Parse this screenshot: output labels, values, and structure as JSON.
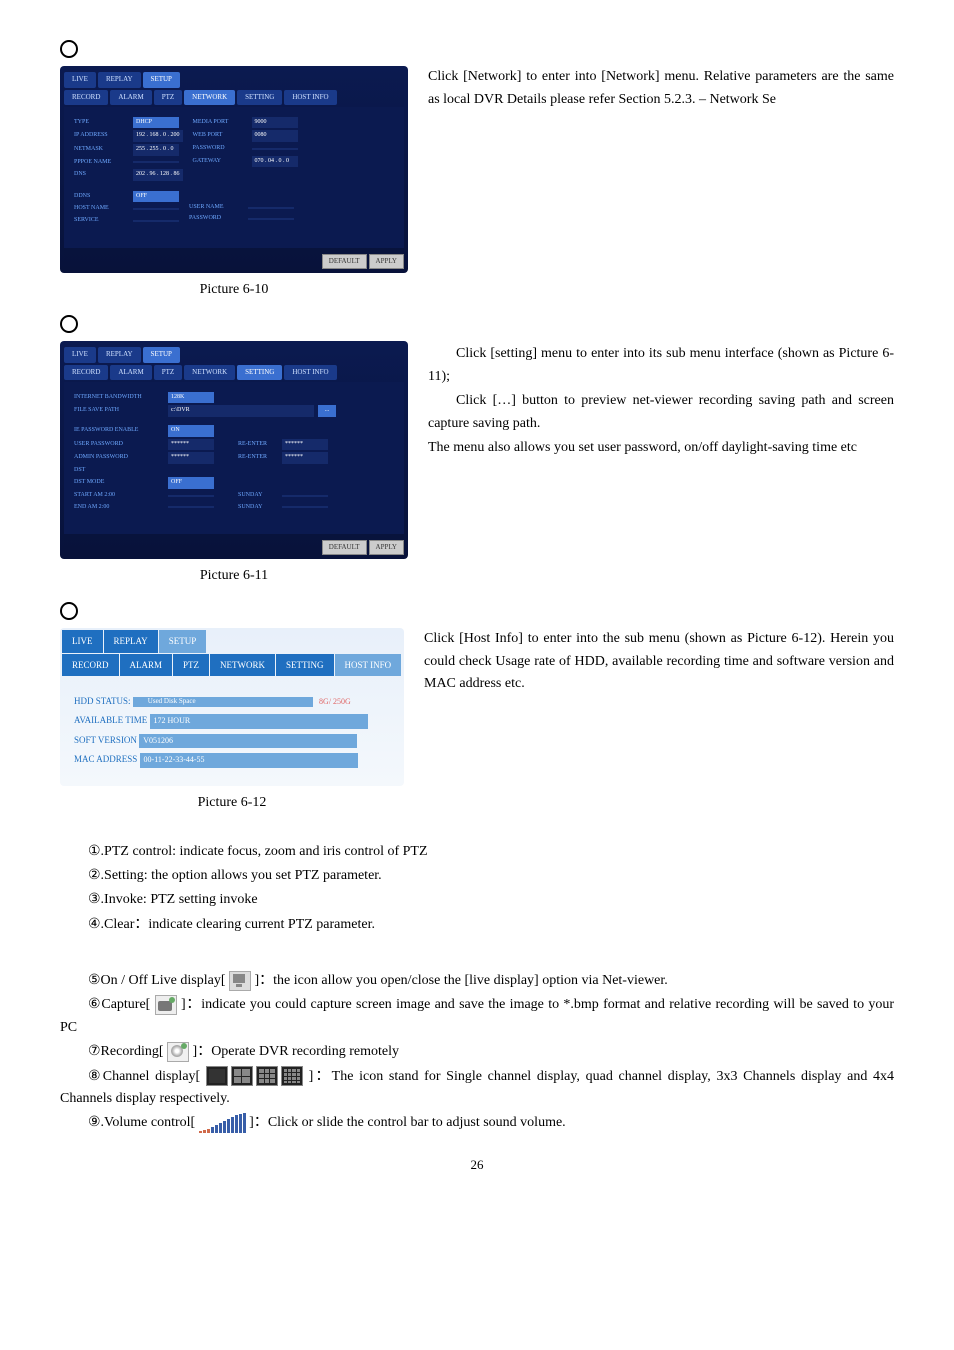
{
  "bullets": {
    "b1": "",
    "b2": "",
    "b3": ""
  },
  "panel_network": {
    "tabs_top": {
      "live": "LIVE",
      "replay": "REPLAY",
      "setup": "SETUP"
    },
    "tabs_sub": {
      "record": "RECORD",
      "alarm": "ALARM",
      "ptz": "PTZ",
      "network": "NETWORK",
      "setting": "SETTING",
      "hostinfo": "HOST INFO"
    },
    "left": {
      "type_k": "TYPE",
      "type_v": "DHCP",
      "ip_k": "IP ADDRESS",
      "ip_v": "192 . 168 . 0 . 200",
      "mask_k": "NETMASK",
      "mask_v": "255 . 255 . 0 . 0",
      "pppoe_k": "PPPOE NAME",
      "pppoe_v": "",
      "dns_k": "DNS",
      "dns_v": "202 . 96 . 128 . 86"
    },
    "mid": {
      "media_k": "MEDIA PORT",
      "media_v": "9000",
      "web_k": "WEB PORT",
      "web_v": "0080",
      "pass_k": "PASSWORD",
      "pass_v": "",
      "gate_k": "GATEWAY",
      "gate_v": "070 . 04 . 0 . 0"
    },
    "bottom": {
      "ddns_k": "DDNS",
      "ddns_v": "OFF",
      "host_k": "HOST NAME",
      "host_v": "",
      "service_k": "SERVICE",
      "service_v": "",
      "user_k": "USER NAME",
      "user_v": "",
      "pass_k": "PASSWORD",
      "pass_v": ""
    },
    "default_btn": "DEFAULT",
    "apply_btn": "APPLY"
  },
  "caption1": "Picture 6-10",
  "text1_a": "Click [Network] to enter into [Network] menu. Relative parameters are the same as local DVR Details please refer Section 5.2.3. – Network Se",
  "panel_setting": {
    "tabs_top": {
      "live": "LIVE",
      "replay": "REPLAY",
      "setup": "SETUP"
    },
    "tabs_sub": {
      "record": "RECORD",
      "alarm": "ALARM",
      "ptz": "PTZ",
      "network": "NETWORK",
      "setting": "SETTING",
      "hostinfo": "HOST INFO"
    },
    "rows": {
      "band_k": "INTERNET BANDWIDTH",
      "band_v": "128K",
      "file_k": "FILE SAVE PATH",
      "file_v": "c:\\DVR",
      "file_btn": "...",
      "pwd_k": "IE PASSWORD ENABLE",
      "pwd_v": "ON",
      "upwd_k": "USER PASSWORD",
      "upwd_v": "******",
      "re1_k": "RE-ENTER",
      "re1_v": "******",
      "apwd_k": "ADMIN PASSWORD",
      "apwd_v": "******",
      "re2_k": "RE-ENTER",
      "re2_v": "******",
      "dst_k": "DST",
      "dst_v": "",
      "dstmode_k": "DST MODE",
      "dstmode_v": "OFF",
      "start_k": "START    AM 2:00",
      "start_v": "",
      "sun1_k": "SUNDAY",
      "sun1_v": "",
      "end_k": "END       AM 2:00",
      "end_v": "",
      "sun2_k": "SUNDAY",
      "sun2_v": ""
    },
    "default_btn": "DEFAULT",
    "apply_btn": "APPLY"
  },
  "caption2": "Picture 6-11",
  "text2_a": "Click [setting] menu to enter into its sub menu interface (shown as Picture 6-11);",
  "text2_b": "Click […] button to preview net-viewer recording saving path and screen capture saving path.",
  "text2_c": "The menu also allows you set user password, on/off daylight-saving time etc",
  "panel_host": {
    "tabs_top": {
      "live": "LIVE",
      "replay": "REPLAY",
      "setup": "SETUP"
    },
    "tabs_sub": {
      "record": "RECORD",
      "alarm": "ALARM",
      "ptz": "PTZ",
      "network": "NETWORK",
      "setting": "SETTING",
      "hostinfo": "HOST INFO"
    },
    "hdd_k": "HDD STATUS:",
    "hdd_bar": "Used Disk Space",
    "hdd_side": "8G/ 250G",
    "avail_k": "AVAILABLE TIME",
    "avail_v": "172 HOUR",
    "soft_k": "SOFT VERSION",
    "soft_v": "V051206",
    "mac_k": "MAC ADDRESS",
    "mac_v": "00-11-22-33-44-55"
  },
  "caption3": "Picture 6-12",
  "text3_a": "Click [Host Info] to enter into the sub menu (shown as Picture 6-12). Herein you could check Usage rate of HDD, available recording time and software version and MAC address etc.",
  "list": {
    "l1": "①.PTZ control: indicate focus, zoom and iris control of PTZ",
    "l2": "②.Setting: the option allows you set PTZ parameter.",
    "l3": "③.Invoke: PTZ setting invoke",
    "l4": "④.Clear：indicate clearing current PTZ parameter.",
    "l5a": "⑤On / Off Live display[ ",
    "l5b": " ]：the icon allow you open/close the [live display] option via Net-viewer.",
    "l6a": "⑥Capture[",
    "l6b": " ]：indicate you could capture screen image and save the image to *.bmp format and relative recording will be saved to your PC",
    "l7a": "⑦Recording[ ",
    "l7b": "]：Operate DVR recording remotely",
    "l8a": "⑧Channel display[ ",
    "l8b": " ]：The icon stand for Single channel display, quad channel display, 3x3 Channels display and 4x4 Channels display respectively.",
    "l9a": "⑨.Volume control[ ",
    "l9b": " ]：Click or slide the control bar to adjust sound volume."
  },
  "page": "26"
}
